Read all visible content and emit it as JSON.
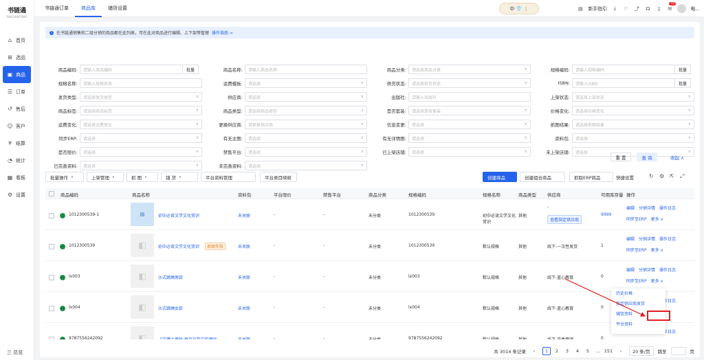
{
  "app": {
    "logo": "书链通",
    "logo_sub": "SHULIANTONG"
  },
  "sidebar": {
    "items": [
      {
        "label": "首页",
        "icon": "home-icon"
      },
      {
        "label": "选品",
        "icon": "select-icon"
      },
      {
        "label": "商品",
        "icon": "goods-icon"
      },
      {
        "label": "订单",
        "icon": "order-icon"
      },
      {
        "label": "售后",
        "icon": "after-sale-icon"
      },
      {
        "label": "客户",
        "icon": "customer-icon"
      },
      {
        "label": "结算",
        "icon": "settle-icon"
      },
      {
        "label": "统计",
        "icon": "stats-icon"
      },
      {
        "label": "看板",
        "icon": "board-icon"
      },
      {
        "label": "设置",
        "icon": "settings-icon"
      }
    ],
    "bottom": "三 总览"
  },
  "topbar": {
    "tabs": [
      "书链通订单",
      "商品库",
      "铺货设置"
    ],
    "lang": "中",
    "guide": "新手指引",
    "badge": "10",
    "user": "电..."
  },
  "notice": {
    "text": "在书链通销售和二级分销的商品都在此列表，可在此对商品进行编辑、上下架等管理",
    "link": "操作指南 >"
  },
  "filters": [
    {
      "label": "商品编码:",
      "ph": "请输入商品编码",
      "btn": "批量"
    },
    {
      "label": "商品名称:",
      "ph": "请输入商品名称"
    },
    {
      "label": "商品分类:",
      "ph": "请选择商品分类",
      "sel": true
    },
    {
      "label": "规格编码:",
      "ph": "请输入规格编码",
      "btn": "批量"
    },
    {
      "label": "规格名称:",
      "ph": "请输入规格名称"
    },
    {
      "label": "运费模板:",
      "ph": "请选择",
      "sel": true
    },
    {
      "label": "供货状态:",
      "ph": "请选择供货状态",
      "sel": true
    },
    {
      "label": "ISBN:",
      "ph": "请输入ISBN",
      "btn": "批量"
    },
    {
      "label": "发货类型:",
      "ph": "请选择发货类型",
      "sel": true
    },
    {
      "label": "供应商:",
      "ph": "请选择",
      "sel": true
    },
    {
      "label": "出版社:",
      "ph": "请输入出版社"
    },
    {
      "label": "上架状态:",
      "ph": "请选择上架状态",
      "sel": true
    },
    {
      "label": "商品标签:",
      "ph": "请选择商品标签",
      "sel": true
    },
    {
      "label": "商品类型:",
      "ph": "请选择商品类型",
      "sel": true
    },
    {
      "label": "是否套装:",
      "ph": "请选择是否套装",
      "sel": true
    },
    {
      "label": "价格变化:",
      "ph": "请选择价格变化",
      "sel": true
    },
    {
      "label": "运费变化:",
      "ph": "请选择运费变化",
      "sel": true
    },
    {
      "label": "更换供应商:",
      "ph": "请更换供应商",
      "sel": true
    },
    {
      "label": "信息变更:",
      "ph": "请选择",
      "sel": true
    },
    {
      "label": "抓图结果:",
      "ph": "请选择抓图结果",
      "sel": true
    },
    {
      "label": "同步ERP:",
      "ph": "请选择",
      "sel": true
    },
    {
      "label": "有无主图:",
      "ph": "请选择",
      "sel": true
    },
    {
      "label": "有无详情图:",
      "ph": "请选择",
      "sel": true
    },
    {
      "label": "资料包:",
      "ph": "请选择",
      "sel": true
    },
    {
      "label": "是否限价:",
      "ph": "请选择",
      "sel": true
    },
    {
      "label": "禁售平台:",
      "ph": "请选择",
      "sel": true
    },
    {
      "label": "已上架店铺:",
      "ph": "请选择",
      "sel": true
    },
    {
      "label": "未上架店铺:",
      "ph": "请选择",
      "sel": true
    },
    {
      "label": "已完善资料:",
      "ph": "请选择",
      "sel": true
    },
    {
      "label": "未完善资料:",
      "ph": "请选择",
      "sel": true
    }
  ],
  "filter_actions": {
    "reset": "重 置",
    "query": "查 询",
    "collapse": "收起 ∧"
  },
  "toolbar": {
    "left": [
      "批量操作",
      "上架管理",
      "抓 图",
      "铺 货",
      "平台资料管理",
      "平台类目映射"
    ],
    "right": [
      "创建商品",
      "创建组合商品",
      "抓取ERP商品"
    ],
    "quick": "快捷设置"
  },
  "table": {
    "headers": [
      "商品编码",
      "商品名称",
      "资料包",
      "平台限价",
      "禁售平台",
      "商品分类",
      "规格编码",
      "规格名称",
      "商品类型",
      "供应商",
      "可用库存量",
      "操作"
    ],
    "rows": [
      {
        "code": "1012300539-1",
        "name": "初中必背文学文化常识",
        "pack": "未关联",
        "limit": "-",
        "ban": "-",
        "cat": "未分类",
        "spec_code": "1012300539",
        "spec_name": "初中必读文学文化常识",
        "type": "其他",
        "supplier": "-",
        "supplier_btn": "查看指定供应商",
        "stock": "9999"
      },
      {
        "code": "1012300539",
        "name": "初中必背文学文化常识",
        "tag": "抓图失败",
        "pack": "未关联",
        "limit": "-",
        "ban": "-",
        "cat": "未分类",
        "spec_code": "1012300539",
        "spec_name": "默认规格",
        "type": "其他",
        "supplier": "线下-一次性发货",
        "stock": "1"
      },
      {
        "code": "lx003",
        "name": "沙式跳绳男款",
        "pack": "未关联",
        "limit": "-",
        "ban": "-",
        "cat": "未分类",
        "spec_code": "lx003",
        "spec_name": "默认规格",
        "type": "其他",
        "supplier": "线下-蓝心教育",
        "stock": "0"
      },
      {
        "code": "lx004",
        "name": "沙式跳绳女款",
        "pack": "未关联",
        "limit": "-",
        "ban": "-",
        "cat": "未分类",
        "spec_code": "lx004",
        "spec_name": "默认规格",
        "type": "其他",
        "supplier": "线下-蓝心教育",
        "stock": "0"
      },
      {
        "code": "9787556242092",
        "name": "《宇博士密码·居贝尔奖中的理化...",
        "pack": "未关联",
        "limit": "-",
        "ban": "-",
        "cat": "未分类",
        "spec_code": "9787556242092",
        "spec_name": "默认规格",
        "type": "其他",
        "supplier": "线下-花香雨润",
        "stock": "0"
      }
    ],
    "ops": {
      "edit": "编辑",
      "detail": "分销详情",
      "log": "操作日志",
      "sync": "同步至ERP",
      "more": "更多 ∨"
    }
  },
  "popup": [
    "历史价格",
    "指定供应商发货",
    "铺货资料",
    "平台资料"
  ],
  "footer": {
    "total": "共 3014 条记录",
    "pages": [
      "1",
      "2",
      "3",
      "4",
      "5",
      "...",
      "151"
    ],
    "size": "20 条/页",
    "jump": "跳至",
    "page_unit": "页"
  }
}
